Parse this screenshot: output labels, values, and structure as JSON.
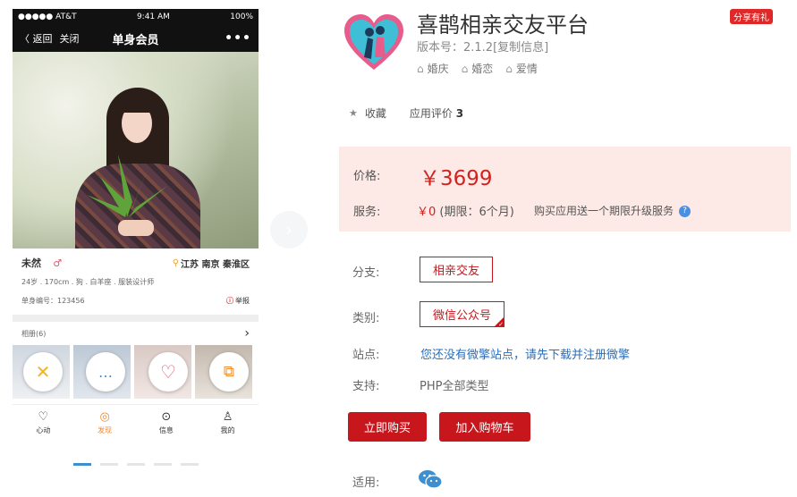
{
  "phone": {
    "status": {
      "carrier": "●●●●● AT&T",
      "time": "9:41 AM",
      "battery": "100%"
    },
    "nav": {
      "back": "〈 返回",
      "close": "关闭",
      "title": "单身会员",
      "more": "•••"
    },
    "profile": {
      "name": "未然",
      "gender_icon": "♂",
      "location": "江苏 南京 秦淮区",
      "details": "24岁 . 170cm . 狗 . 白羊座 . 服装设计师",
      "member_id": "单身编号：123456",
      "report": "举报"
    },
    "album": {
      "label": "相册(6)",
      "chevron": "›"
    },
    "actions": [
      "✕",
      "…",
      "♡",
      "⧉"
    ],
    "tabs": [
      {
        "label": "心动",
        "icon": "heart-icon"
      },
      {
        "label": "发现",
        "icon": "compass-icon"
      },
      {
        "label": "信息",
        "icon": "message-icon"
      },
      {
        "label": "我的",
        "icon": "user-icon"
      }
    ],
    "carousel_count": 5,
    "carousel_active": 0
  },
  "app": {
    "title": "喜鹊相亲交友平台",
    "share": "分享有礼",
    "version": "版本号：2.1.2[复制信息]",
    "tags": [
      "婚庆",
      "婚恋",
      "爱情"
    ],
    "favorite": "收藏",
    "rating_label": "应用评价",
    "rating_count": "3"
  },
  "pricing": {
    "price_label": "价格:",
    "price": "￥3699",
    "service_label": "服务:",
    "service_price": "￥0",
    "service_term": "(期限：6个月)",
    "service_promo": "购买应用送一个期限升级服务",
    "help": "?"
  },
  "options": {
    "branch_label": "分支:",
    "branch_value": "相亲交友",
    "category_label": "类别:",
    "category_value": "微信公众号",
    "site_label": "站点:",
    "site_value": "您还没有微擎站点，请先下载并注册微擎",
    "support_label": "支持:",
    "support_value": "PHP全部类型",
    "applicable_label": "适用:"
  },
  "buttons": {
    "buy": "立即购买",
    "cart": "加入购物车"
  },
  "colors": {
    "accent": "#c8161d",
    "price": "#d0221f",
    "link": "#2a6eb8",
    "price_bg": "#fdeae6"
  }
}
